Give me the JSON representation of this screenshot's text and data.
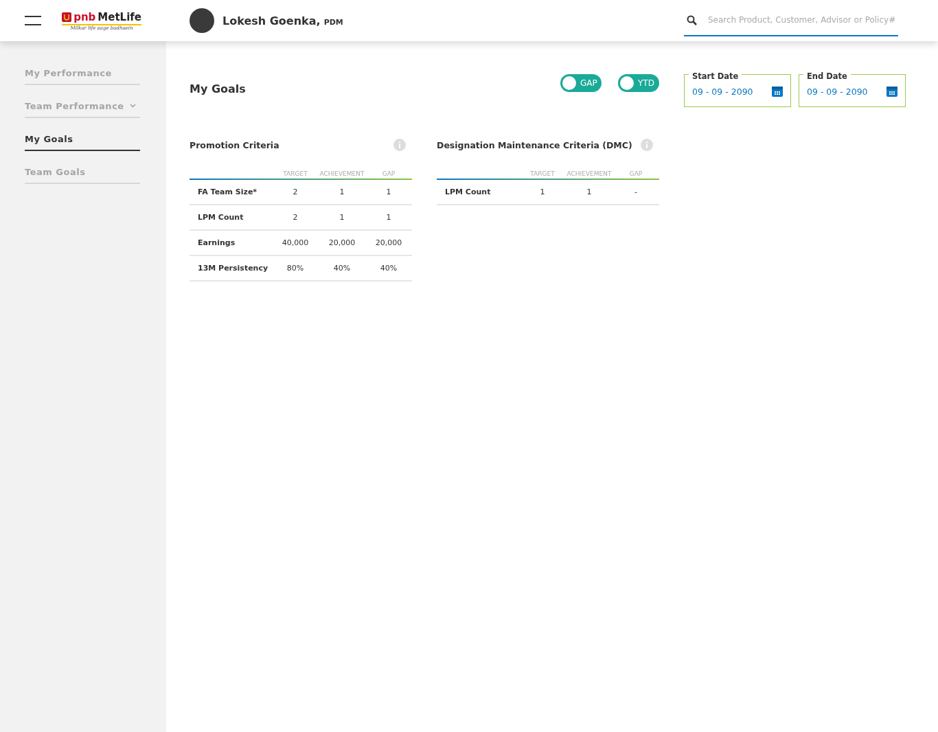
{
  "header": {
    "logo": {
      "brand_prefix": "pnb",
      "brand_name": "MetLife",
      "tagline": "Milkar life aage badhaein"
    },
    "user": {
      "name": "Lokesh Goenka,",
      "role": "PDM"
    },
    "search": {
      "placeholder": "Search Product, Customer, Advisor or Policy#"
    }
  },
  "sidebar": {
    "items": [
      {
        "label": "My Performance",
        "selected": false,
        "expandable": false
      },
      {
        "label": "Team Performance",
        "selected": false,
        "expandable": true
      },
      {
        "label": "My Goals",
        "selected": true,
        "expandable": false
      },
      {
        "label": "Team Goals",
        "selected": false,
        "expandable": false
      }
    ]
  },
  "page_title": "My Goals",
  "toggles": [
    {
      "label": "GAP",
      "on": false
    },
    {
      "label": "YTD",
      "on": false
    }
  ],
  "date_fields": [
    {
      "label": "Start Date",
      "value": "09 - 09 - 2090"
    },
    {
      "label": "End Date",
      "value": "09 - 09 - 2090"
    }
  ],
  "tables": [
    {
      "title": "Promotion Criteria",
      "columns": [
        "TARGET",
        "ACHIEVEMENT",
        "GAP"
      ],
      "rows": [
        {
          "name": "FA Team Size*",
          "cells": [
            "2",
            "1",
            "1"
          ]
        },
        {
          "name": "LPM Count",
          "cells": [
            "2",
            "1",
            "1"
          ]
        },
        {
          "name": "Earnings",
          "cells": [
            "40,000",
            "20,000",
            "20,000"
          ]
        },
        {
          "name": "13M Persistency",
          "cells": [
            "80%",
            "40%",
            "40%"
          ]
        }
      ]
    },
    {
      "title": "Designation Maintenance Criteria (DMC)",
      "columns": [
        "TARGET",
        "ACHIEVEMENT",
        "GAP"
      ],
      "rows": [
        {
          "name": "LPM Count",
          "cells": [
            "1",
            "1",
            "-"
          ]
        }
      ]
    }
  ]
}
